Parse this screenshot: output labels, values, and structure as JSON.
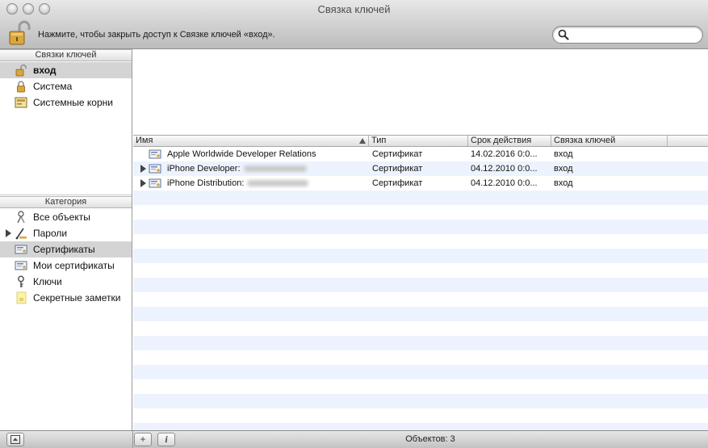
{
  "window": {
    "title": "Связка ключей"
  },
  "toolbar": {
    "lock_hint": "Нажмите, чтобы закрыть доступ к Связке ключей «вход».",
    "search_placeholder": "",
    "search_value": ""
  },
  "sidebar": {
    "keychains_header": "Связки ключей",
    "keychains": [
      {
        "label": "вход",
        "icon": "open-lock-icon",
        "selected": true
      },
      {
        "label": "Система",
        "icon": "lock-icon",
        "selected": false
      },
      {
        "label": "Системные корни",
        "icon": "certificate-folder-icon",
        "selected": false
      }
    ],
    "category_header": "Категория",
    "categories": [
      {
        "label": "Все объекты",
        "icon": "all-items-icon",
        "selected": false
      },
      {
        "label": "Пароли",
        "icon": "passwords-icon",
        "selected": false,
        "expandable": true
      },
      {
        "label": "Сертификаты",
        "icon": "certificate-icon",
        "selected": true
      },
      {
        "label": "Мои сертификаты",
        "icon": "my-certificate-icon",
        "selected": false
      },
      {
        "label": "Ключи",
        "icon": "key-icon",
        "selected": false
      },
      {
        "label": "Секретные заметки",
        "icon": "secure-note-icon",
        "selected": false
      }
    ]
  },
  "table": {
    "columns": [
      "Имя",
      "Тип",
      "Срок действия",
      "Связка ключей"
    ],
    "sort_column": "Имя",
    "sort_direction": "ascending",
    "rows": [
      {
        "name": "Apple Worldwide Developer Relations",
        "type": "Сертификат",
        "expires": "14.02.2016 0:0...",
        "keychain": "вход",
        "expandable": false
      },
      {
        "name": "iPhone Developer:",
        "type": "Сертификат",
        "expires": "04.12.2010 0:0...",
        "keychain": "вход",
        "expandable": true
      },
      {
        "name": "iPhone Distribution:",
        "type": "Сертификат",
        "expires": "04.12.2010 0:0...",
        "keychain": "вход",
        "expandable": true
      }
    ]
  },
  "statusbar": {
    "item_count": "Объектов: 3",
    "add_label": "+",
    "info_label": "i"
  },
  "colors": {
    "selection": "#d4d4d4",
    "stripe": "#edf3fe",
    "lock_gold": "#d9a640"
  }
}
